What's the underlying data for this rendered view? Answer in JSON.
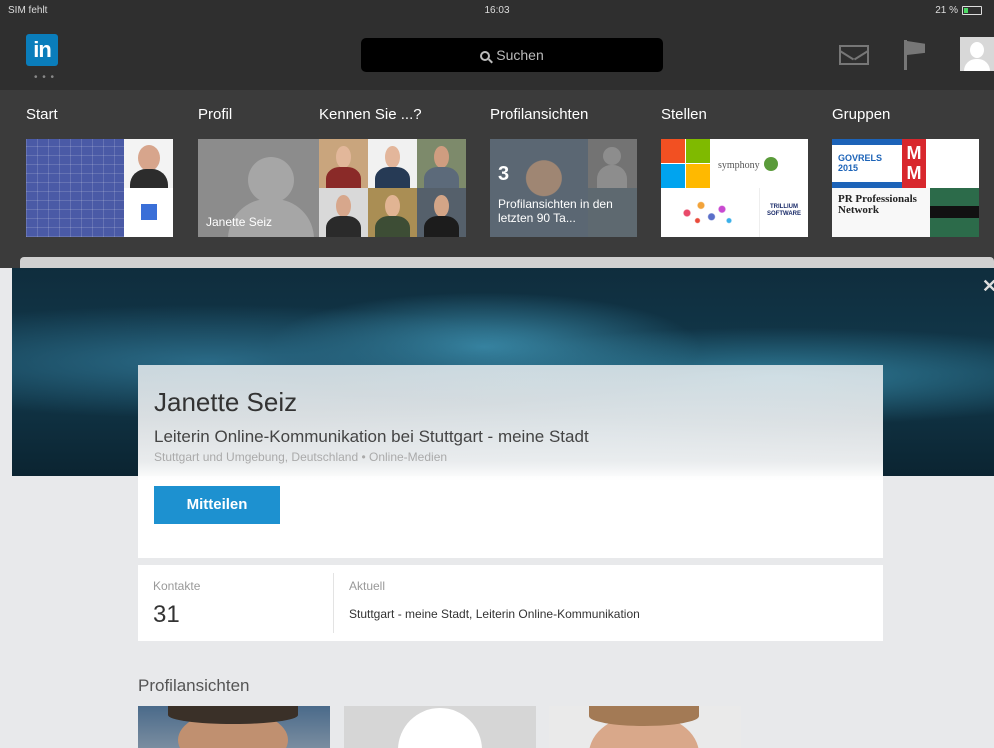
{
  "status_bar": {
    "carrier": "SIM fehlt",
    "time": "16:03",
    "battery": "21 %"
  },
  "header": {
    "logo": "in",
    "search_placeholder": "Suchen",
    "icons": [
      "mail-icon",
      "flag-icon",
      "profile-icon"
    ]
  },
  "nav": {
    "start": {
      "label": "Start"
    },
    "profil": {
      "label": "Profil",
      "tile_name": "Janette Seiz"
    },
    "kennen": {
      "label": "Kennen Sie ...?"
    },
    "views": {
      "label": "Profilansichten",
      "count": "3",
      "caption": "Profilansichten in den letzten 90 Ta..."
    },
    "stellen": {
      "label": "Stellen",
      "tile_texts": [
        "symphony",
        "TRILLIUM SOFTWARE"
      ]
    },
    "gruppen": {
      "label": "Gruppen",
      "tile_texts": [
        "GOVRELS 2015",
        "M M",
        "PR Professionals Network"
      ]
    }
  },
  "profile": {
    "name": "Janette Seiz",
    "headline": "Leiterin Online-Kommunikation bei Stuttgart - meine Stadt",
    "location": "Stuttgart und Umgebung, Deutschland • Online-Medien",
    "share_button": "Mitteilen",
    "contacts_label": "Kontakte",
    "contacts_value": "31",
    "current_label": "Aktuell",
    "current_value": "Stuttgart - meine Stadt, Leiterin Online-Kommunikation",
    "views_title": "Profilansichten"
  },
  "colors": {
    "accent": "#1d91d0",
    "logo": "#0a7dbb",
    "topbar": "#2f2f2f"
  }
}
